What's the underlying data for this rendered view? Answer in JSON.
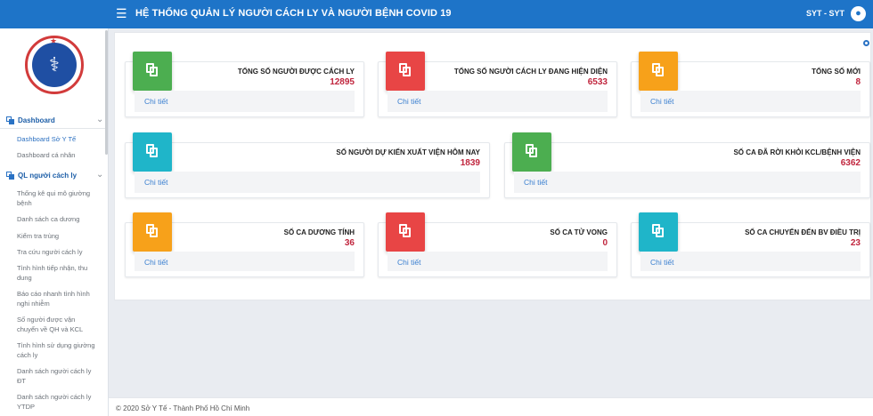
{
  "header": {
    "title": "HỆ THỐNG QUẢN LÝ NGƯỜI CÁCH LY VÀ NGƯỜI BỆNH COVID 19",
    "menu_icon": "☰",
    "user": "SYT - SYT",
    "user_icon": "●",
    "color": "#1e74c8"
  },
  "sidebar": {
    "logo_icon": "⚕",
    "sections": [
      {
        "label": "Dashboard",
        "items": [
          "Dashboard Sở Y Tế",
          "Dashboard cá nhân"
        ]
      },
      {
        "label": "QL người cách ly",
        "items": [
          "Thống kê qui mô giường bệnh",
          "Danh sách ca dương",
          "Kiểm tra trùng",
          "Tra cứu người cách ly",
          "Tình hình tiếp nhận, thu dung",
          "Báo cáo nhanh tình hình nghi nhiễm",
          "Số người được vận chuyển về QH và KCL",
          "Tình hình sử dụng giường cách ly",
          "Danh sách người cách ly ĐT",
          "Danh sách người cách ly YTDP"
        ]
      }
    ]
  },
  "cards": [
    {
      "label": "TỔNG SỐ NGƯỜI ĐƯỢC CÁCH LY",
      "value": "12895",
      "detail": "Chi tiết",
      "color": "#4cae50"
    },
    {
      "label": "TỔNG SỐ NGƯỜI CÁCH LY ĐANG HIỆN DIỆN",
      "value": "6533",
      "detail": "Chi tiết",
      "color": "#e84545"
    },
    {
      "label": "TỔNG SỐ MỚI",
      "value": "8",
      "detail": "Chi tiết",
      "color": "#f7a11a"
    },
    {
      "label": "SỐ NGƯỜI DỰ KIẾN XUẤT VIỆN HÔM NAY",
      "value": "1839",
      "detail": "Chi tiết",
      "color": "#1fb5c9"
    },
    {
      "label": "SỐ CA ĐÃ RỜI KHỎI KCL/BỆNH VIỆN",
      "value": "6362",
      "detail": "Chi tiết",
      "color": "#4cae50"
    },
    {
      "label": "SỐ CA DƯƠNG TÍNH",
      "value": "36",
      "detail": "Chi tiết",
      "color": "#f7a11a"
    },
    {
      "label": "SỐ CA TỬ VONG",
      "value": "0",
      "detail": "Chi tiết",
      "color": "#e84545"
    },
    {
      "label": "SỐ CA CHUYỂN ĐẾN BV ĐIỀU TRỊ",
      "value": "23",
      "detail": "Chi tiết",
      "color": "#1fb5c9"
    }
  ],
  "footer": {
    "text": "© 2020 Sở Y Tế - Thành Phố Hồ Chí Minh"
  }
}
